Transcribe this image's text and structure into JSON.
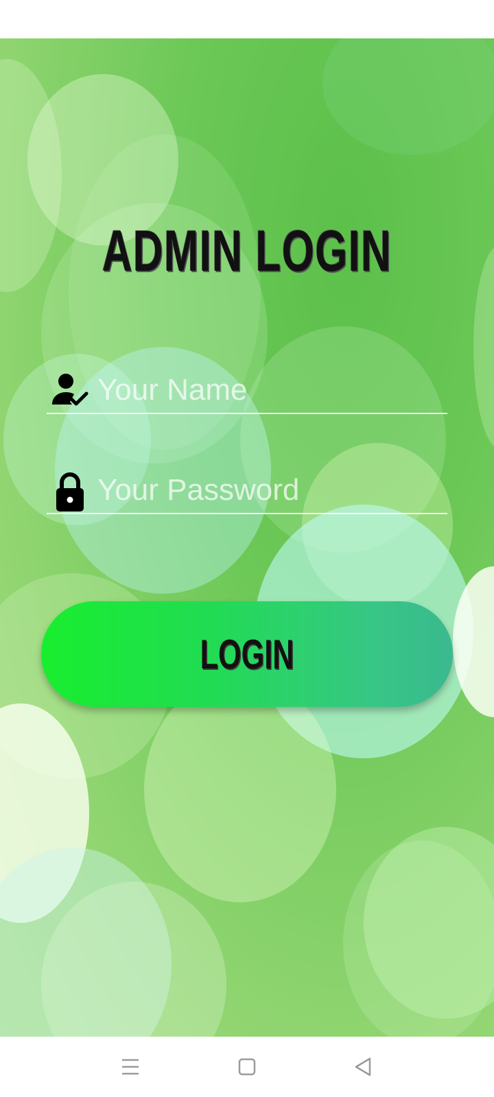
{
  "screen": {
    "title": "ADMIN LOGIN",
    "background_color": "#6cc857"
  },
  "form": {
    "name_field": {
      "placeholder": "Your Name",
      "value": "",
      "icon": "person-check-icon"
    },
    "password_field": {
      "placeholder": "Your Password",
      "value": "",
      "icon": "lock-icon"
    },
    "login_label": "LOGIN",
    "login_gradient": [
      "#18ee2e",
      "#3ab98f"
    ]
  },
  "nav_bar": {
    "menu": "menu-icon",
    "home": "home-icon",
    "back": "back-icon"
  }
}
